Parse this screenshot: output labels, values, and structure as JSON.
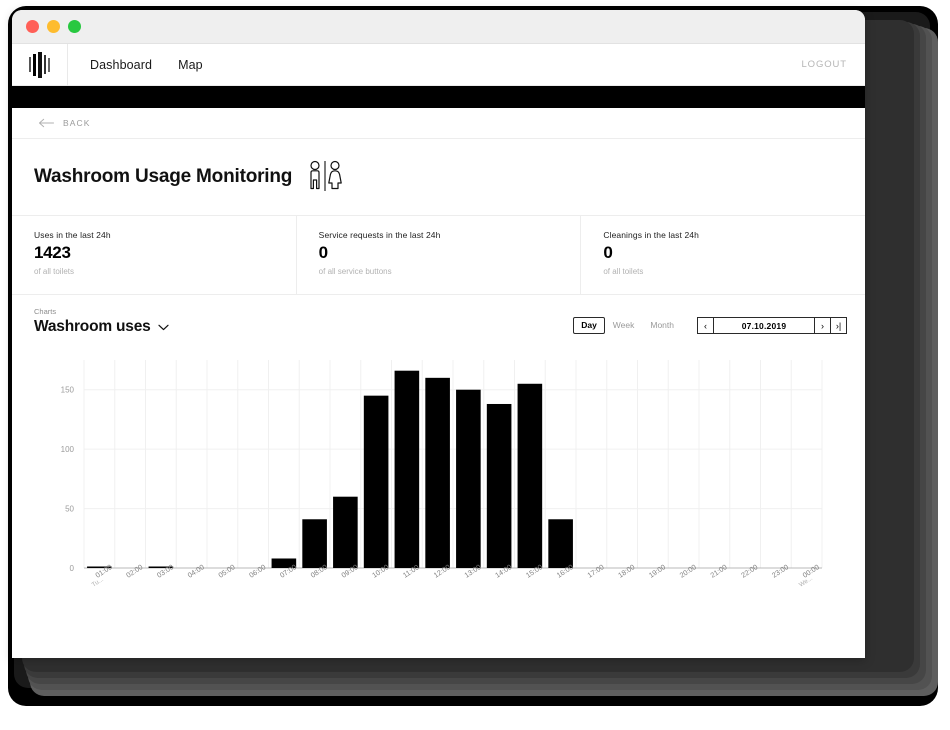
{
  "window": {
    "traffic_lights": [
      "close",
      "minimize",
      "maximize"
    ]
  },
  "nav": {
    "logo_name": "bar-logo",
    "links": [
      {
        "label": "Dashboard"
      },
      {
        "label": "Map"
      }
    ],
    "logout_label": "LOGOUT"
  },
  "back": {
    "label": "BACK"
  },
  "header": {
    "title": "Washroom Usage Monitoring",
    "icon": "washroom-icon"
  },
  "stats": [
    {
      "label": "Uses in the last 24h",
      "value": "1423",
      "sub": "of all toilets"
    },
    {
      "label": "Service requests in the last 24h",
      "value": "0",
      "sub": "of all service buttons"
    },
    {
      "label": "Cleanings in the last 24h",
      "value": "0",
      "sub": "of all toilets"
    }
  ],
  "charts_section": {
    "kicker": "Charts",
    "title": "Washroom uses",
    "dropdown_icon": "chevron-down-icon",
    "ranges": [
      {
        "label": "Day",
        "active": true
      },
      {
        "label": "Week",
        "active": false
      },
      {
        "label": "Month",
        "active": false
      }
    ],
    "date_nav": {
      "prev_label": "‹",
      "date": "07.10.2019",
      "next_label": "›",
      "last_label": "›|"
    }
  },
  "chart_data": {
    "type": "bar",
    "title": "Washroom uses",
    "xlabel": "",
    "ylabel": "",
    "ylim": [
      0,
      175
    ],
    "yticks": [
      0,
      50,
      100,
      150
    ],
    "grid": true,
    "legend": false,
    "categories": [
      "01:00",
      "02:00",
      "03:00",
      "04:00",
      "05:00",
      "06:00",
      "07:00",
      "08:00",
      "09:00",
      "10:00",
      "11:00",
      "12:00",
      "13:00",
      "14:00",
      "15:00",
      "16:00",
      "17:00",
      "18:00",
      "19:00",
      "20:00",
      "21:00",
      "22:00",
      "23:00",
      "00:00"
    ],
    "day_labels": {
      "01:00": "Tu...",
      "00:00": "We..."
    },
    "values": [
      1,
      0,
      1,
      0,
      0,
      0,
      8,
      41,
      60,
      145,
      166,
      160,
      150,
      138,
      155,
      41,
      0,
      0,
      0,
      0,
      0,
      0,
      0,
      0
    ],
    "bar_color": "#000000"
  },
  "colors": {
    "accent": "#000000",
    "muted_text": "#9b9b9b",
    "grid": "#f0f0f0",
    "titlebar": "#efefef"
  }
}
